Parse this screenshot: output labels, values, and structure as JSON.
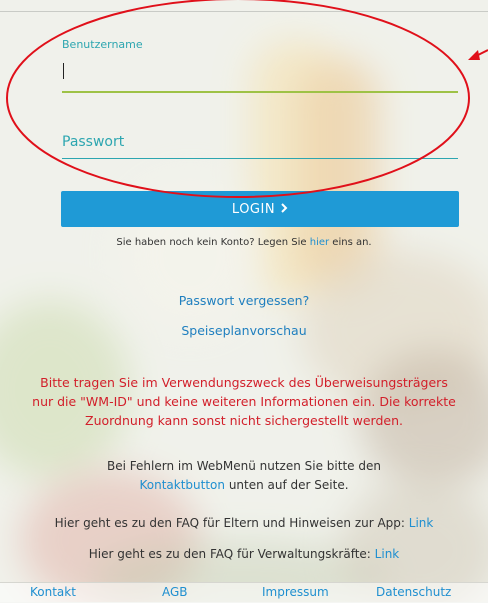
{
  "login": {
    "username_label": "Benutzername",
    "username_value": "",
    "password_label": "Passwort",
    "password_value": "",
    "login_button": "LOGIN",
    "login_icon": "chevron-right-icon",
    "no_account_prefix": "Sie haben noch kein Konto? Legen Sie ",
    "no_account_link": "hier",
    "no_account_suffix": " eins an."
  },
  "links": {
    "forgot_password": "Passwort vergessen?",
    "menu_preview": "Speiseplanvorschau"
  },
  "notice": {
    "warning": "Bitte tragen Sie im Verwendungszweck des Überweisungsträgers nur die \"WM-ID\" und keine weiteren Informationen ein. Die korrekte Zuordnung kann sonst nicht sichergestellt werden.",
    "help_prefix": "Bei Fehlern im WebMenü nutzen Sie bitte den",
    "help_link": "Kontaktbutton",
    "help_suffix": " unten auf der Seite.",
    "faq_parents_text": "Hier geht es zu den FAQ für Eltern und Hinweisen zur App: ",
    "faq_parents_link": "Link",
    "faq_staff_text": "Hier geht es zu den FAQ für Verwaltungskräfte: ",
    "faq_staff_link": "Link"
  },
  "footer": {
    "items": [
      "Kontakt",
      "AGB",
      "Impressum",
      "Datenschutz"
    ]
  },
  "colors": {
    "accent": "#1f9ad6",
    "label": "#2da6b0",
    "warning": "#d21f2a",
    "annotation": "#e0101a"
  }
}
